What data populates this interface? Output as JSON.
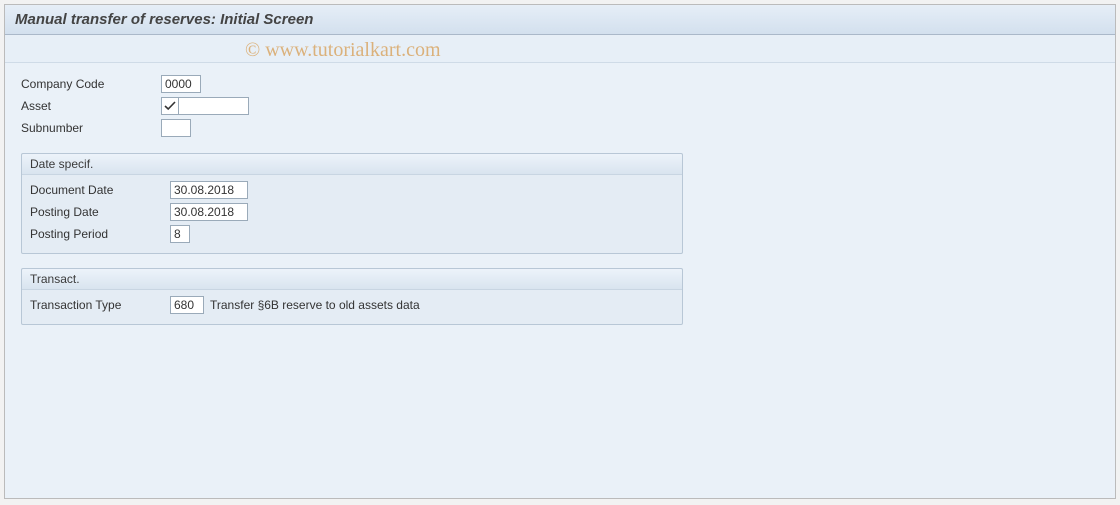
{
  "window": {
    "title": "Manual transfer of reserves: Initial Screen"
  },
  "watermark": "© www.tutorialkart.com",
  "top_fields": {
    "company_code": {
      "label": "Company Code",
      "value": "0000"
    },
    "asset": {
      "label": "Asset",
      "checked": true
    },
    "subnumber": {
      "label": "Subnumber",
      "value": ""
    }
  },
  "groups": {
    "date_specif": {
      "title": "Date specif.",
      "document_date": {
        "label": "Document Date",
        "value": "30.08.2018"
      },
      "posting_date": {
        "label": "Posting Date",
        "value": "30.08.2018"
      },
      "posting_period": {
        "label": "Posting Period",
        "value": "8"
      }
    },
    "transact": {
      "title": "Transact.",
      "transaction_type": {
        "label": "Transaction Type",
        "value": "680",
        "description": "Transfer §6B reserve to old assets data"
      }
    }
  }
}
